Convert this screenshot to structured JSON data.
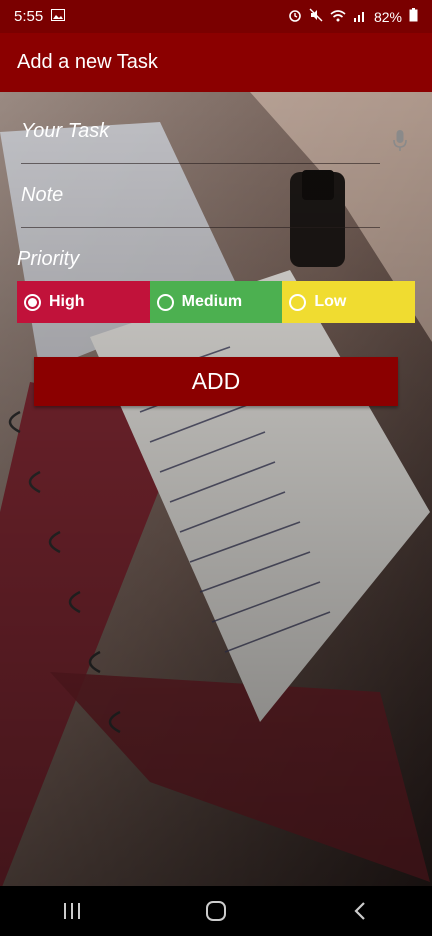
{
  "status_bar": {
    "time": "5:55",
    "battery": "82%"
  },
  "toolbar": {
    "title": "Add a new Task"
  },
  "form": {
    "task_placeholder": "Your Task",
    "note_placeholder": "Note",
    "priority_label": "Priority",
    "priorities": [
      {
        "label": "High",
        "color": "#c1123a",
        "selected": true
      },
      {
        "label": "Medium",
        "color": "#4cb050",
        "selected": false
      },
      {
        "label": "Low",
        "color": "#f0dc30",
        "selected": false
      }
    ],
    "add_label": "ADD"
  },
  "colors": {
    "accent": "#8b0000",
    "status_bar": "#7a0000"
  }
}
